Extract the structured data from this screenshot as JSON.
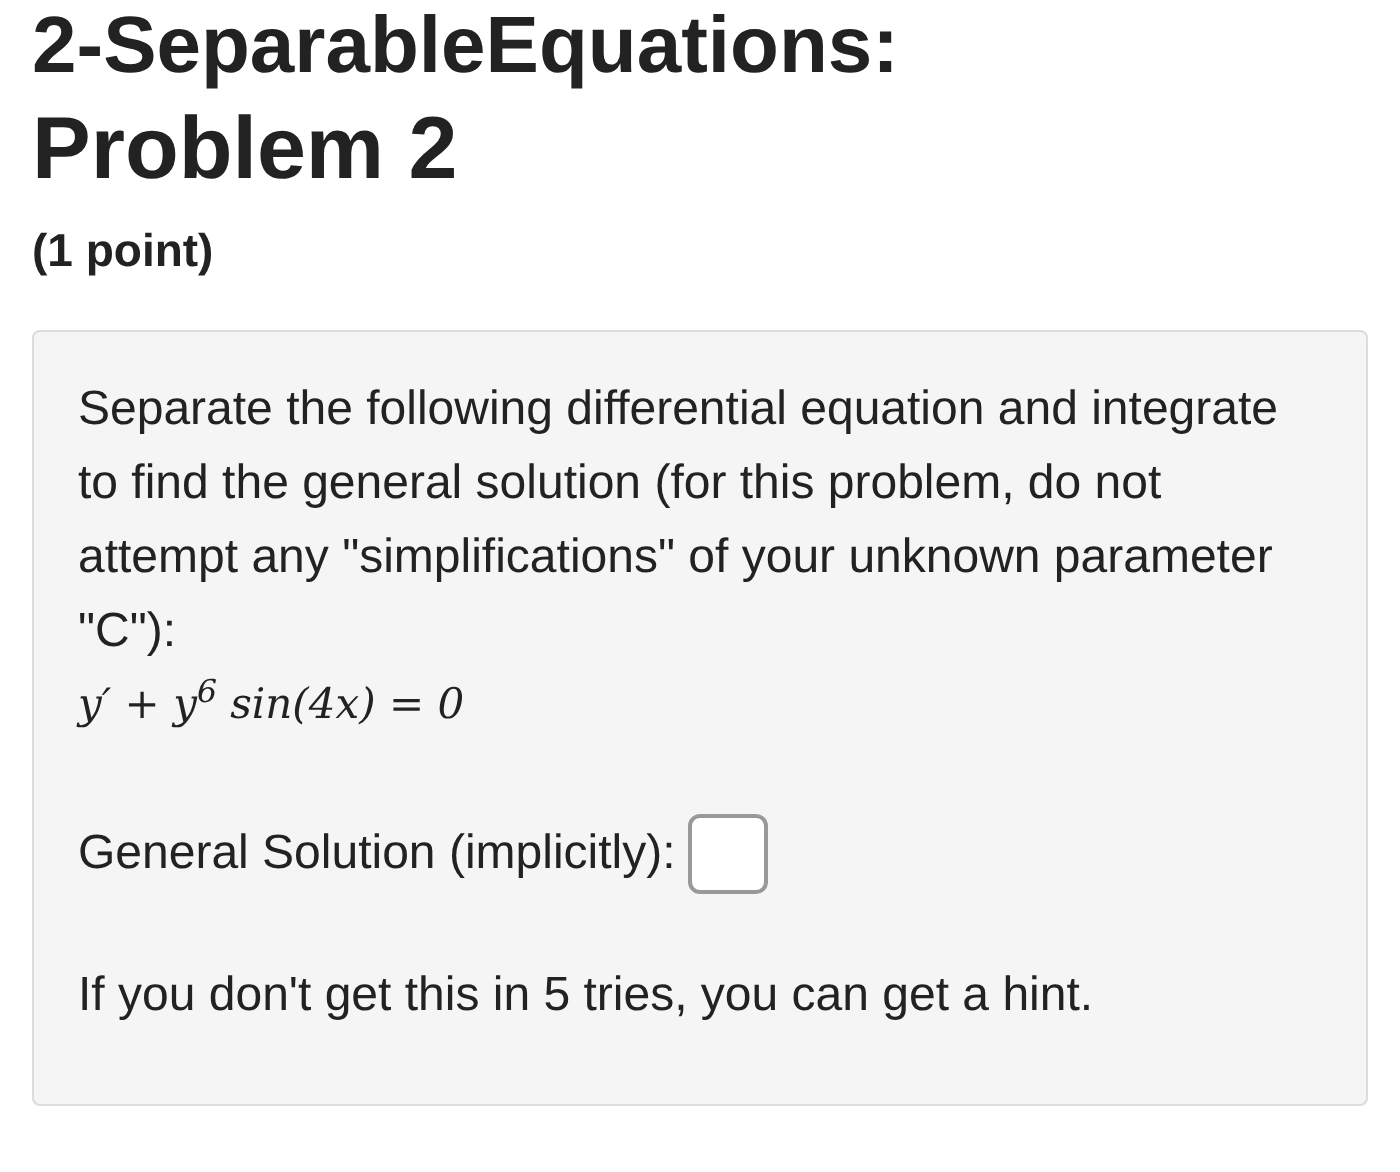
{
  "heading": {
    "line_1": "2-SeparableEquations:",
    "line_2": "Problem 2"
  },
  "points": "(1 point)",
  "problem": {
    "text": "Separate the following differential equation and integrate to find the general solution (for this problem, do not attempt any \"simplifications\" of your unknown parameter \"C\"):",
    "equation": "y′ + y$^{6}$ sin(4x) = 0",
    "answer_label": "General Solution (implicitly):",
    "hint_note": "If you don't get this in 5 tries, you can get a hint."
  }
}
